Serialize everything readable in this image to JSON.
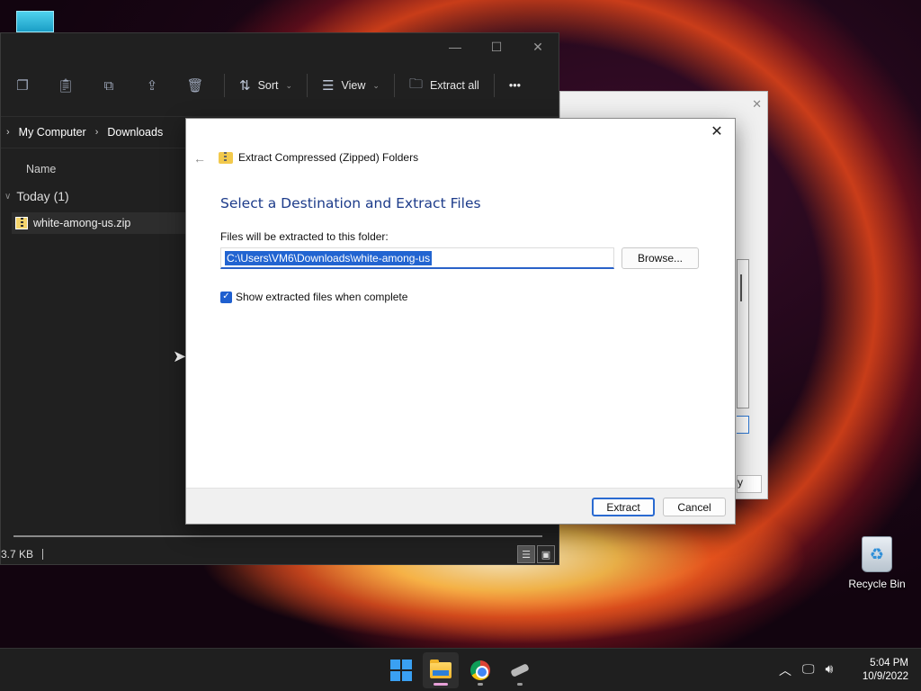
{
  "explorer": {
    "toolbar": {
      "sort_label": "Sort",
      "view_label": "View",
      "extract_all_label": "Extract all",
      "more_label": "•••"
    },
    "breadcrumb": [
      "My Computer",
      "Downloads"
    ],
    "column_name": "Name",
    "group_label": "Today (1)",
    "files": [
      {
        "name": "white-among-us.zip"
      }
    ],
    "status_size": "3.7 KB"
  },
  "back_dialog": {
    "button_fragment": "y"
  },
  "dialog": {
    "window_title": "Extract Compressed (Zipped) Folders",
    "heading": "Select a Destination and Extract Files",
    "destination_label": "Files will be extracted to this folder:",
    "destination_value": "C:\\Users\\VM6\\Downloads\\white-among-us",
    "browse_label": "Browse...",
    "show_files_label": "Show extracted files when complete",
    "show_files_checked": true,
    "extract_label": "Extract",
    "cancel_label": "Cancel"
  },
  "desktop": {
    "recycle_bin_label": "Recycle Bin"
  },
  "taskbar": {
    "time": "5:04 PM",
    "date": "10/9/2022",
    "accent_color": "#3aa0f2"
  }
}
